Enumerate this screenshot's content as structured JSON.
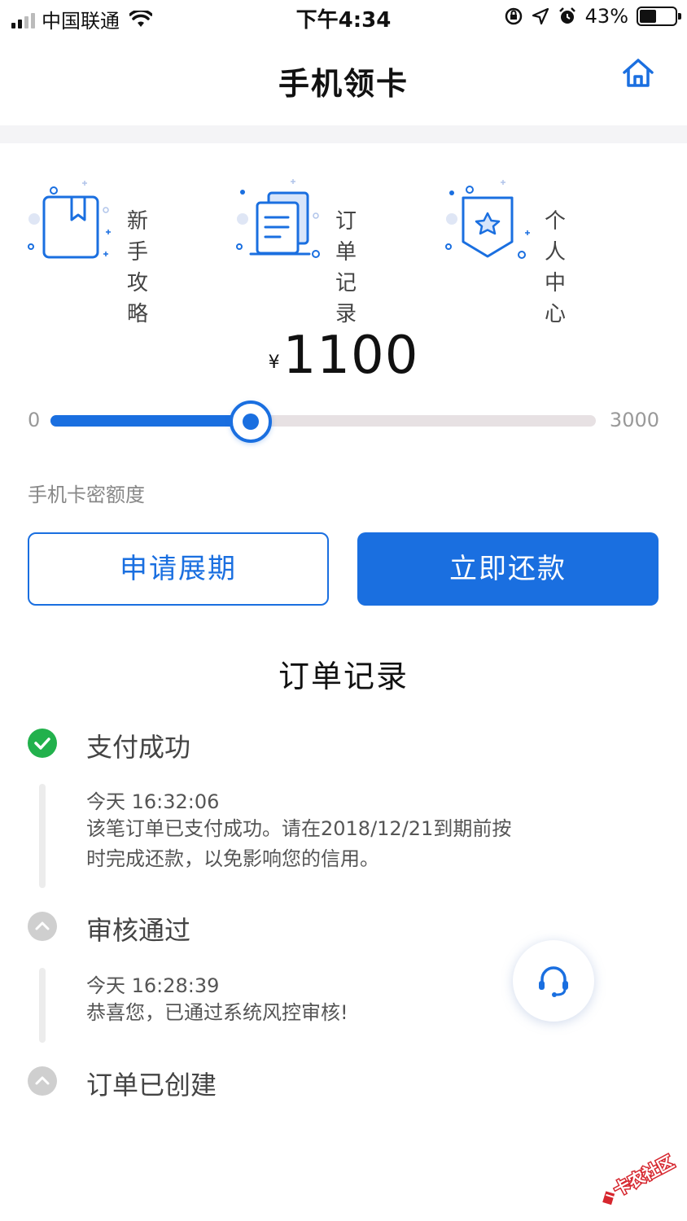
{
  "status_bar": {
    "carrier": "中国联通",
    "time": "下午4:34",
    "battery_percent": "43%"
  },
  "header": {
    "title": "手机领卡",
    "home_icon": "home-icon"
  },
  "quick_menu": [
    {
      "label_line1": "新手",
      "label_line2": "攻略",
      "icon": "guide-book-icon"
    },
    {
      "label_line1": "订单",
      "label_line2": "记录",
      "icon": "order-document-icon"
    },
    {
      "label_line1": "个人",
      "label_line2": "中心",
      "icon": "personal-star-badge-icon"
    }
  ],
  "amount": {
    "currency": "¥",
    "value": "1100"
  },
  "slider": {
    "min": "0",
    "max": "3000",
    "current": 1100
  },
  "limit_label": "手机卡密额度",
  "buttons": {
    "extend": "申请展期",
    "repay": "立即还款"
  },
  "colors": {
    "accent": "#1a6fe0",
    "success": "#22b14c",
    "inactive": "#cfcfcf"
  },
  "order_section_title": "订单记录",
  "timeline": [
    {
      "title": "支付成功",
      "status": "success",
      "time": "今天 16:32:06",
      "desc_line1": "该笔订单已支付成功。请在2018/12/21到期前按",
      "desc_line2": "时完成还款，以免影响您的信用。"
    },
    {
      "title": "审核通过",
      "status": "collapsed",
      "time": "今天 16:28:39",
      "desc_line1": "恭喜您，已通过系统风控审核!"
    },
    {
      "title": "订单已创建",
      "status": "collapsed"
    }
  ],
  "float_button_icon": "customer-service-headset-icon",
  "watermark_text": "卡农社区"
}
